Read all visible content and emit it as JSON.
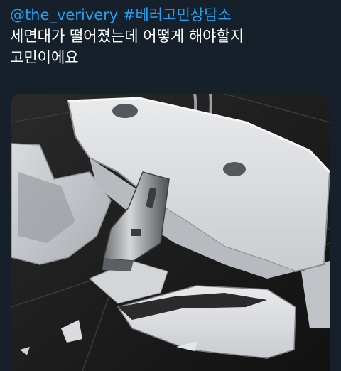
{
  "tweet": {
    "mention": "@the_verivery",
    "hashtag": "#베러고민상담소",
    "line2": "세면대가 떨어졌는데 어떻게 해야할지",
    "line3": "고민이에요"
  },
  "media": {
    "icon": "broken-sink-photo"
  },
  "colors": {
    "background": "#15202b",
    "text": "#ffffff",
    "link": "#1da1f2"
  }
}
